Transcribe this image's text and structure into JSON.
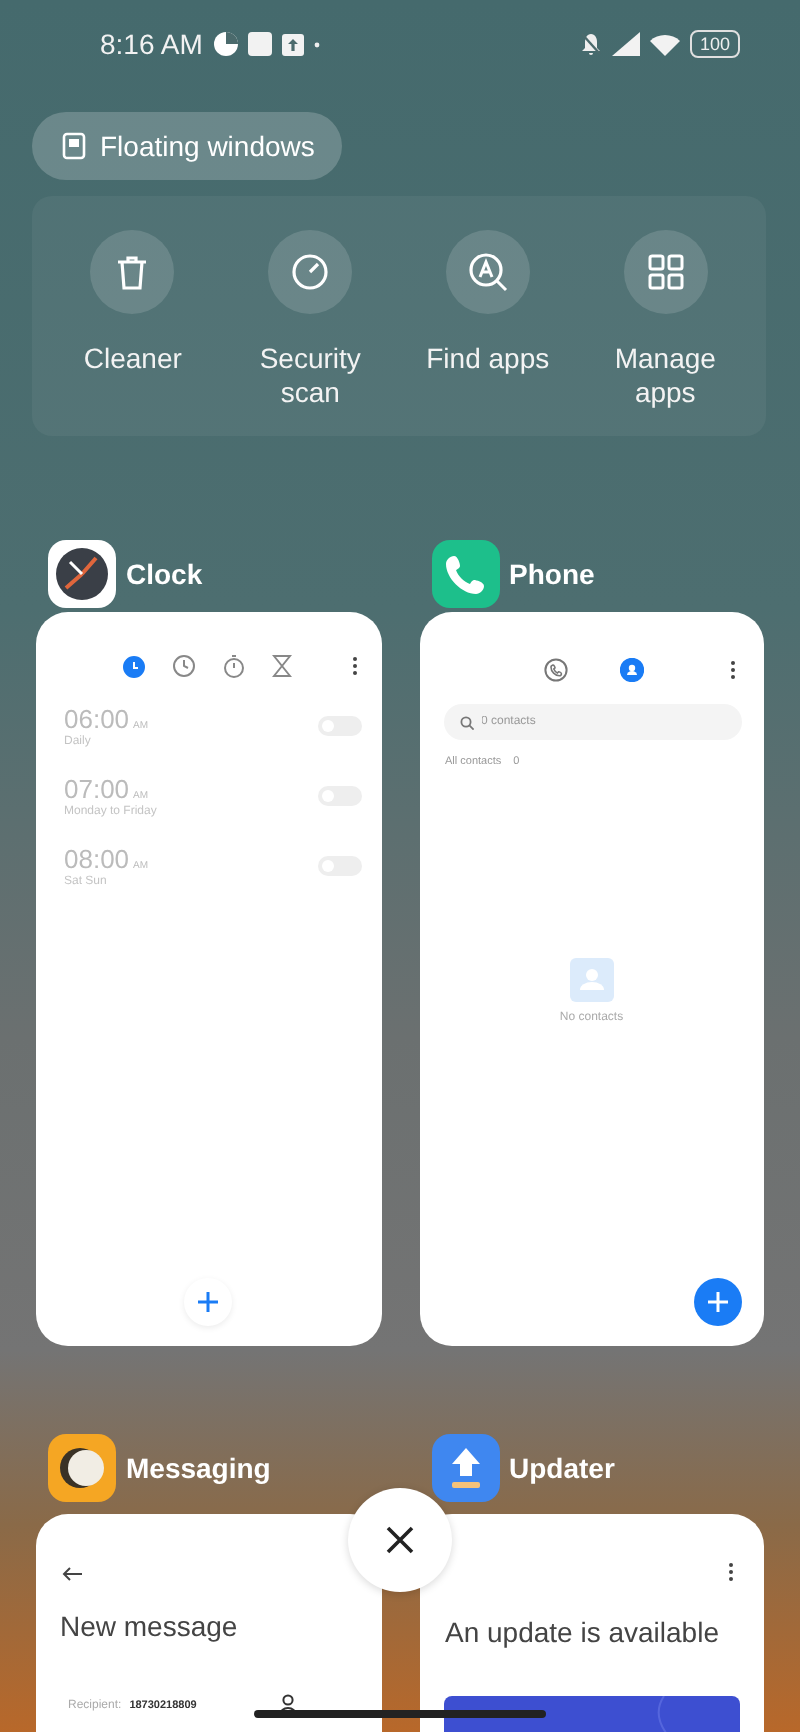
{
  "status_bar": {
    "time": "8:16 AM",
    "battery": "100"
  },
  "floating_windows": {
    "label": "Floating windows"
  },
  "quick_actions": [
    {
      "kind": "cleaner",
      "label": "Cleaner"
    },
    {
      "kind": "security",
      "label": "Security scan"
    },
    {
      "kind": "find",
      "label": "Find apps"
    },
    {
      "kind": "manage",
      "label": "Manage apps"
    }
  ],
  "apps": [
    {
      "kind": "clock",
      "name": "Clock",
      "tabs": [
        {
          "kind": "alarm",
          "selected": true
        },
        {
          "kind": "clock",
          "selected": false
        },
        {
          "kind": "stopwatch",
          "selected": false
        },
        {
          "kind": "timer",
          "selected": false
        }
      ],
      "alarms": [
        {
          "time": "06:00",
          "period": "AM",
          "repeat": "Daily",
          "on": false
        },
        {
          "time": "07:00",
          "period": "AM",
          "repeat": "Monday to Friday",
          "on": false
        },
        {
          "time": "08:00",
          "period": "AM",
          "repeat": "Sat Sun",
          "on": false
        }
      ]
    },
    {
      "kind": "phone",
      "name": "Phone",
      "tabs": [
        {
          "kind": "calls",
          "selected": false
        },
        {
          "kind": "contacts",
          "selected": true
        }
      ],
      "search": {
        "placeholder": "0 contacts"
      },
      "section": "All contacts",
      "count": "0",
      "empty": "No contacts"
    },
    {
      "kind": "messaging",
      "name": "Messaging",
      "title": "New message",
      "recipient_label": "Recipient:",
      "recipient": "18730218809"
    },
    {
      "kind": "updater",
      "name": "Updater",
      "headline": "An update is available"
    }
  ]
}
